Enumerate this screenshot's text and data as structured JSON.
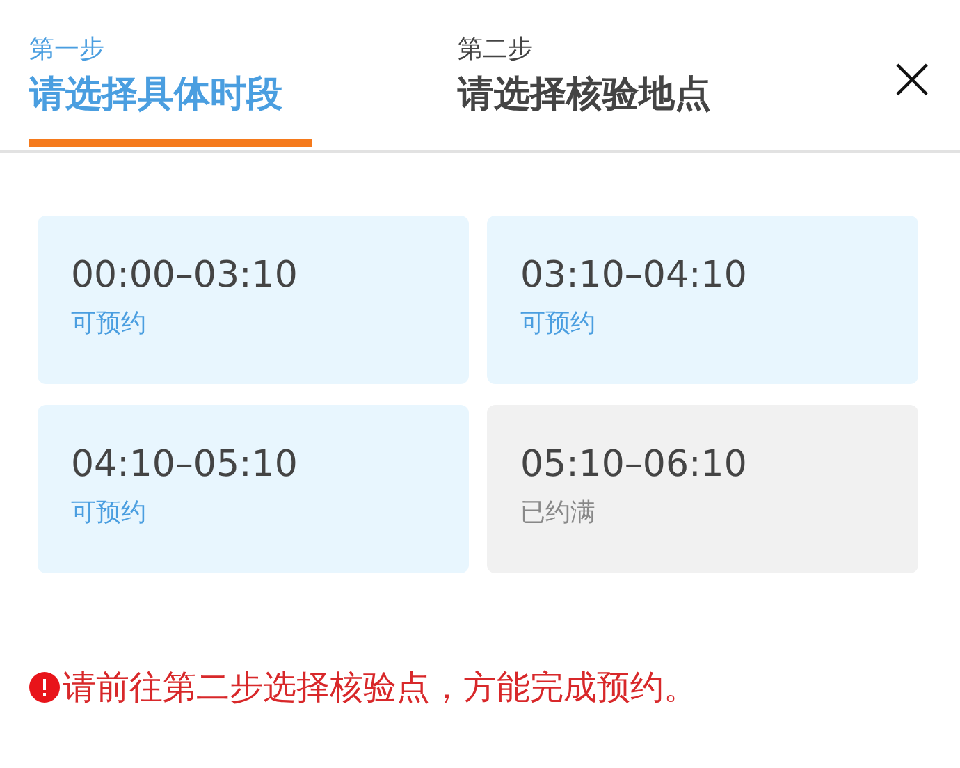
{
  "steps": [
    {
      "step": "第一步",
      "label": "请选择具体时段",
      "selected": true
    },
    {
      "step": "第二步",
      "label": "请选择核验地点",
      "selected": false
    }
  ],
  "close": "×",
  "slots": [
    {
      "time": "00:00–03:10",
      "status": "可预约",
      "available": true
    },
    {
      "time": "03:10–04:10",
      "status": "可预约",
      "available": true
    },
    {
      "time": "04:10–05:10",
      "status": "可预约",
      "available": true
    },
    {
      "time": "05:10–06:10",
      "status": "已约满",
      "available": false
    }
  ],
  "notice": "请前往第二步选择核验点，方能完成预约。"
}
